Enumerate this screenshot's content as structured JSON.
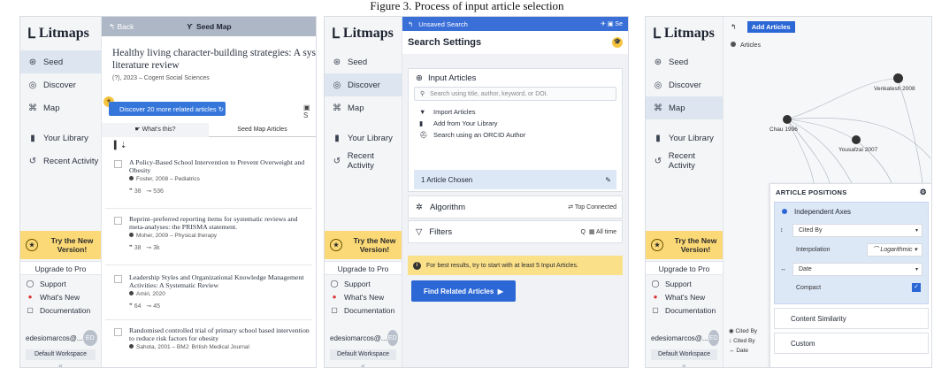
{
  "figure_caption": "Figure 3. Process of input article selection",
  "sidebar": {
    "logo": "Litmaps",
    "items": [
      {
        "label": "Seed",
        "icon": "seed-icon"
      },
      {
        "label": "Discover",
        "icon": "discover-icon"
      },
      {
        "label": "Map",
        "icon": "map-icon"
      },
      {
        "label": "Your Library",
        "icon": "library-icon"
      },
      {
        "label": "Recent Activity",
        "icon": "history-icon"
      }
    ],
    "try_new": "Try the New Version!",
    "upgrade": "Upgrade to Pro",
    "support": "Support",
    "whats_new": "What's New",
    "documentation": "Documentation",
    "user": "edesiomarcos@...",
    "avatar": "ED",
    "workspace": "Default Workspace",
    "collapse": "«"
  },
  "seed_panel": {
    "back": "Back",
    "title": "Seed Map",
    "paper_title": "Healthy living character-building strategies: A systemat literature review",
    "paper_title_line1": "Healthy living character-building strategies: A systemat",
    "paper_title_line2": "literature review",
    "paper_meta": "(?), 2023 – Cogent Social Sciences",
    "discover_button": "Discover 20 more related articles",
    "whats_this": "What's this?",
    "seed_map_articles": "Seed Map Articles",
    "articles": [
      {
        "title": "A Policy-Based School Intervention to Prevent Overweight and Obesity",
        "meta": "Foster, 2008 – Pediatrics",
        "refs": "38",
        "cites": "536"
      },
      {
        "title": "Reprint–preferred reporting items for systematic reviews and meta-analyses: the PRISMA statement.",
        "meta": "Moher, 2009 – Physical therapy",
        "refs": "38",
        "cites": "3k"
      },
      {
        "title": "Leadership Styles and Organizational Knowledge Management Activities: A Systematic Review",
        "meta": "Amiri, 2020",
        "refs": "64",
        "cites": "45"
      },
      {
        "title": "Randomised controlled trial of primary school based intervention to reduce risk factors for obesity",
        "meta": "Sahota, 2001 – BMJ: British Medical Journal",
        "refs": "",
        "cites": ""
      }
    ]
  },
  "search_panel": {
    "top": "Unsaved Search",
    "heading": "Search Settings",
    "input_articles": "Input Articles",
    "search_placeholder": "Search using title, author, keyword, or DOI.",
    "import": "Import Articles",
    "add_library": "Add from Your Library",
    "orcid": "Search using an ORCID Author",
    "chosen": "1 Article Chosen",
    "algorithm": "Algorithm",
    "algorithm_value": "Top Connected",
    "filters": "Filters",
    "filters_value": "All time",
    "tip": "For best results, try to start with at least 5 Input Articles.",
    "find": "Find Related Articles"
  },
  "map_panel": {
    "add_articles": "Add Articles",
    "legend": "Articles",
    "nodes": [
      {
        "label": "Venkatesh 2008"
      },
      {
        "label": "Chau 1996"
      },
      {
        "label": "Yousafzai 2007"
      }
    ],
    "article_positions": "ARTICLE POSITIONS",
    "independent_axes": "Independent Axes",
    "cited_by": "Cited By",
    "interpolation": "Interpolation",
    "logarithmic": "Logarithmic",
    "date": "Date",
    "compact": "Compact",
    "content_similarity": "Content Similarity",
    "custom": "Custom",
    "axes_legend": [
      "Cited By",
      "Cited By",
      "Date"
    ]
  }
}
